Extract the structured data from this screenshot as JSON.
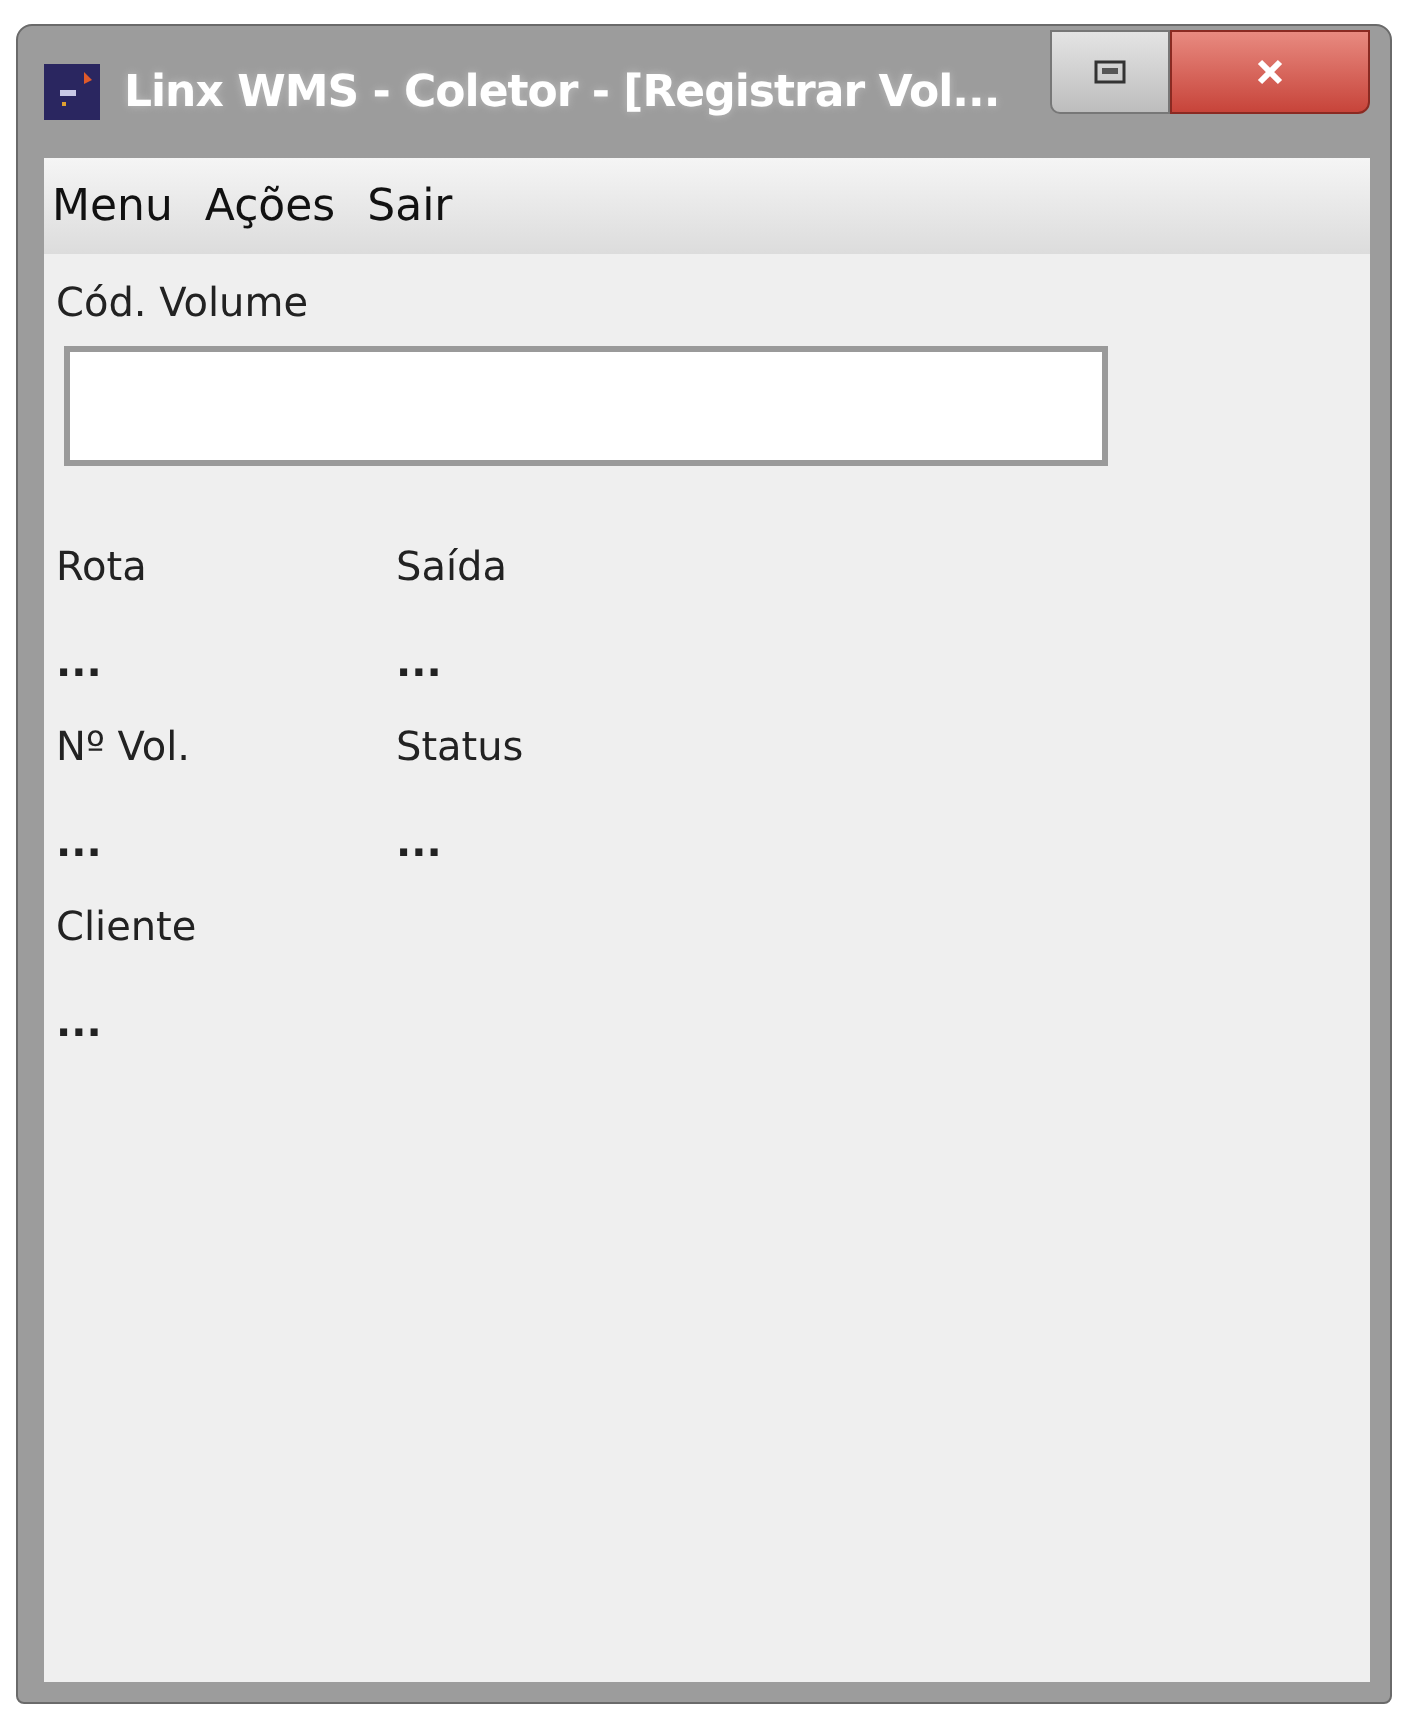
{
  "window": {
    "title": "Linx WMS - Coletor - [Registrar Vol..."
  },
  "menu": [
    "Menu",
    "Ações",
    "Sair"
  ],
  "volume_field": {
    "label": "Cód. Volume"
  },
  "fields": [
    {
      "label": "Rota",
      "value": "..."
    },
    {
      "label": "Saída",
      "value": "..."
    },
    {
      "label": "Nº Vol.",
      "value": "..."
    },
    {
      "label": "Status",
      "value": "..."
    },
    {
      "label": "Cliente",
      "value": "..."
    }
  ]
}
